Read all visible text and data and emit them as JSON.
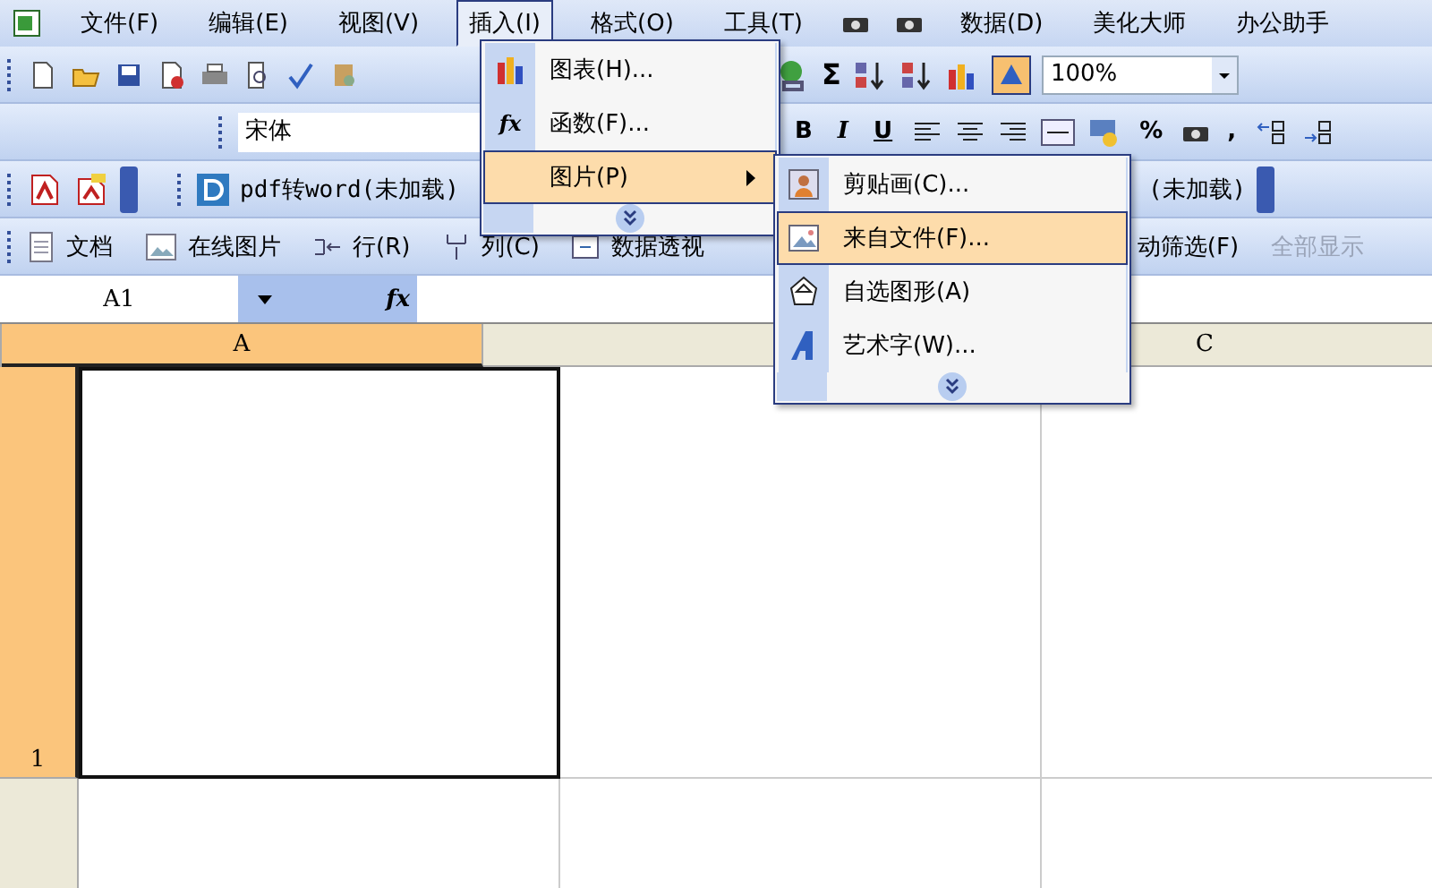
{
  "menu_bar": [
    {
      "label": "文件(F)",
      "selected": false
    },
    {
      "label": "编辑(E)",
      "selected": false
    },
    {
      "label": "视图(V)",
      "selected": false
    },
    {
      "label": "插入(I)",
      "selected": true
    },
    {
      "label": "格式(O)",
      "selected": false
    },
    {
      "label": "工具(T)",
      "selected": false
    },
    {
      "label": "数据(D)",
      "selected": false
    },
    {
      "label": "美化大师",
      "selected": false
    },
    {
      "label": "办公助手",
      "selected": false
    }
  ],
  "standard_toolbar": {
    "sum": "Σ",
    "zoom": "100%"
  },
  "formatting_toolbar": {
    "font": "宋体",
    "buttons": [
      "B",
      "I",
      "U",
      "%",
      ","
    ]
  },
  "plugin_toolbar": {
    "items": [
      "pdf转word(未加载)",
      "(未加载)"
    ]
  },
  "data_toolbar": {
    "items": [
      {
        "label": "文档",
        "disabled": false
      },
      {
        "label": "在线图片",
        "disabled": false
      },
      {
        "label": "行(R)",
        "disabled": false
      },
      {
        "label": "列(C)",
        "disabled": false
      },
      {
        "label": "数据透视",
        "disabled": false
      },
      {
        "label": "动筛选(F)",
        "disabled": false
      },
      {
        "label": "全部显示",
        "disabled": true
      }
    ]
  },
  "name_box": "A1",
  "function_symbol": "fx",
  "columns": [
    {
      "label": "A",
      "selected": true
    },
    {
      "selected": false
    },
    {
      "label": "C",
      "selected": false
    }
  ],
  "rows": [
    {
      "label": "1",
      "selected": true
    }
  ],
  "insert_menu": {
    "items": [
      {
        "kind": "item",
        "label": "图表(H)...",
        "selected": false
      },
      {
        "kind": "item",
        "label": "函数(F)...",
        "selected": false,
        "icon_text": "fx"
      },
      {
        "kind": "submenu",
        "label": "图片(P)",
        "selected": true
      },
      {
        "kind": "more"
      }
    ]
  },
  "picture_submenu": {
    "items": [
      {
        "kind": "item",
        "label": "剪贴画(C)...",
        "selected": false
      },
      {
        "kind": "item",
        "label": "来自文件(F)...",
        "selected": true
      },
      {
        "kind": "item",
        "label": "自选图形(A)",
        "selected": false
      },
      {
        "kind": "item",
        "label": "艺术字(W)...",
        "selected": false
      },
      {
        "kind": "more"
      }
    ]
  }
}
